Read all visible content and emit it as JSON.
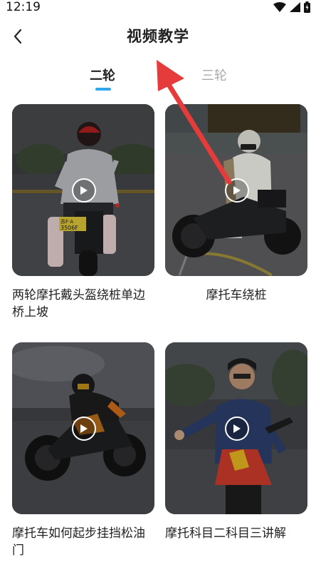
{
  "status_bar": {
    "time": "12:19"
  },
  "header": {
    "title": "视频教学"
  },
  "tabs": [
    {
      "label": "二轮",
      "selected": true
    },
    {
      "label": "三轮",
      "selected": false
    }
  ],
  "videos": [
    {
      "title": "两轮摩托戴头盔绕桩单边桥上坡"
    },
    {
      "title": "摩托车绕桩"
    },
    {
      "title": "摩托车如何起步挂挡松油门"
    },
    {
      "title": "摩托科目二科目三讲解"
    }
  ],
  "thumb0": {
    "plate_text": "苏F·A",
    "plate_num": "3506F"
  },
  "colors": {
    "accent": "#33a7ec",
    "arrow": "#e63b3b",
    "tab_inactive": "#aaaaaa"
  }
}
